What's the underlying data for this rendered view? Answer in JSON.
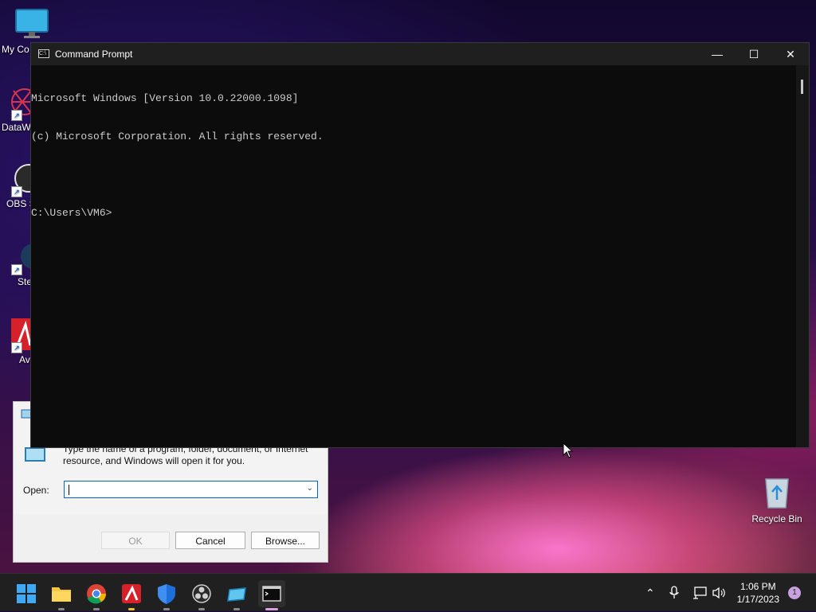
{
  "desktop": {
    "icons": [
      {
        "label": "My Co"
      },
      {
        "label": "DataW"
      },
      {
        "label": "OBS S"
      },
      {
        "label": "Ste"
      },
      {
        "label": "Av"
      }
    ],
    "recycle_bin": {
      "label": "Recycle Bin"
    }
  },
  "cmd_window": {
    "title": "Command Prompt",
    "minimize": "—",
    "maximize": "☐",
    "close": "✕",
    "console_lines": [
      "Microsoft Windows [Version 10.0.22000.1098]",
      "(c) Microsoft Corporation. All rights reserved.",
      "",
      "C:\\Users\\VM6>"
    ]
  },
  "run_dialog": {
    "description": "Type the name of a program, folder, document, or Internet resource, and Windows will open it for you.",
    "open_label": "Open:",
    "open_value": "",
    "ok_label": "OK",
    "cancel_label": "Cancel",
    "browse_label": "Browse..."
  },
  "taskbar": {
    "apps": [
      {
        "name": "start-button",
        "icon": "windows-icon"
      },
      {
        "name": "file-explorer",
        "icon": "folder-icon"
      },
      {
        "name": "chrome",
        "icon": "chrome-icon"
      },
      {
        "name": "avira",
        "icon": "avira-icon"
      },
      {
        "name": "defender",
        "icon": "shield-icon"
      },
      {
        "name": "obs",
        "icon": "obs-icon"
      },
      {
        "name": "app",
        "icon": "app-icon"
      },
      {
        "name": "cmd",
        "icon": "terminal-icon"
      }
    ],
    "clock_time": "1:06 PM",
    "clock_date": "1/17/2023",
    "notification_count": "1"
  }
}
